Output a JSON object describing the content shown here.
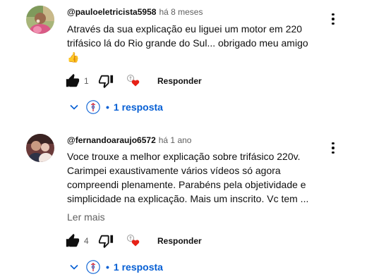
{
  "comments": [
    {
      "author": "@pauloeletricista5958",
      "time": "há 8 meses",
      "lines": [
        "Através da sua explicação eu liguei um motor em 220",
        "trifásico lá do Rio grande do Sul... obrigado meu amigo"
      ],
      "emoji": "👍",
      "like_count": "1",
      "reply_label": "Responder",
      "replies_label": "1 resposta",
      "menu_icon": "more-vert-icon"
    },
    {
      "author": "@fernandoaraujo6572",
      "time": "há 1 ano",
      "lines": [
        "Voce trouxe a melhor explicação sobre trifásico 220v.",
        "Carimpei exaustivamente vários vídeos só agora",
        "compreendi plenamente. Parabéns pela objetividade e",
        "simplicidade na explicação.  Mais um inscrito. Vc tem ..."
      ],
      "read_more": "Ler mais",
      "like_count": "4",
      "reply_label": "Responder",
      "replies_label": "1 resposta",
      "menu_icon": "more-vert-icon"
    }
  ],
  "colors": {
    "link_blue": "#065fd4",
    "secondary_text": "#606060",
    "primary_text": "#0f0f0f",
    "heart_red": "#e62117"
  }
}
